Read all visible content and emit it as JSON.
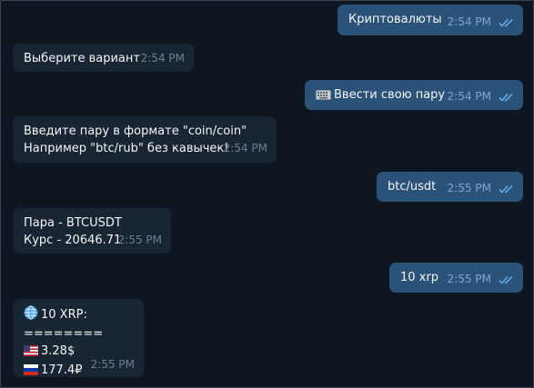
{
  "messages": [
    {
      "dir": "out",
      "lines": [
        "Криптовалюты"
      ],
      "time": "2:54 PM"
    },
    {
      "dir": "in",
      "lines": [
        "Выберите вариант"
      ],
      "time": "2:54 PM"
    },
    {
      "dir": "out",
      "emoji": "keyboard-icon",
      "lines": [
        "Ввести свою пару"
      ],
      "time": "2:54 PM"
    },
    {
      "dir": "in",
      "lines": [
        "Введите пару в формате \"coin/coin\"",
        "Например \"btc/rub\" без кавычек!"
      ],
      "time": "2:54 PM"
    },
    {
      "dir": "out",
      "lines": [
        "btc/usdt"
      ],
      "time": "2:55 PM"
    },
    {
      "dir": "in",
      "lines": [
        "Пара - BTCUSDT",
        "Курс - 20646.71"
      ],
      "time": "2:55 PM"
    },
    {
      "dir": "out",
      "lines": [
        "10 xrp"
      ],
      "time": "2:55 PM"
    },
    {
      "dir": "in",
      "lines": [
        "10 XRP:",
        "========",
        "3.28$",
        "177.4₽"
      ],
      "line_icons": [
        "globe-icon",
        "",
        "us-flag-icon",
        "ru-flag-icon"
      ],
      "time": "2:55 PM"
    }
  ],
  "colors": {
    "background": "#0e1621",
    "incoming_bubble": "#182533",
    "outgoing_bubble": "#2b5278",
    "read_check": "#6ab3f3"
  }
}
